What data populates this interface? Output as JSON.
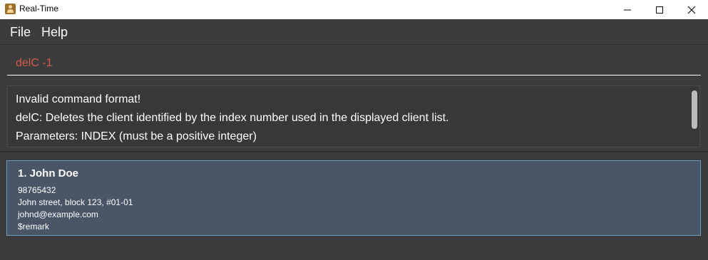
{
  "window": {
    "title": "Real-Time",
    "icon": "app-icon",
    "controls": [
      "minimize-icon",
      "maximize-icon",
      "close-icon"
    ]
  },
  "menu": {
    "file": "File",
    "help": "Help"
  },
  "command": {
    "value": "delC -1",
    "text_color": "#d35b4c"
  },
  "result": {
    "lines": [
      "Invalid command format!",
      "delC: Deletes the client identified by the index number used in the displayed client list.",
      "Parameters: INDEX (must be a positive integer)"
    ]
  },
  "clients": [
    {
      "index_name": "1.  John Doe",
      "phone": "98765432",
      "address": "John street, block 123, #01-01",
      "email": "johnd@example.com",
      "remark": "$remark"
    }
  ],
  "colors": {
    "background": "#3c3c3c",
    "card": "#4a5568",
    "card_border": "#6a9cc4"
  }
}
